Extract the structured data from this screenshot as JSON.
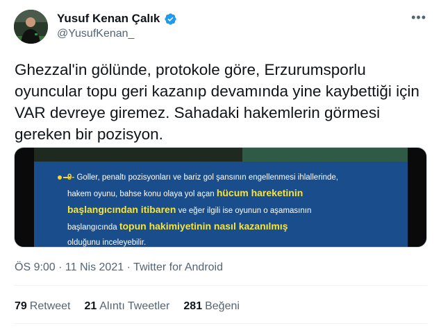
{
  "author": {
    "name": "Yusuf Kenan Çalık",
    "handle": "@YusufKenan_"
  },
  "tweet": {
    "text": "Ghezzal'in gölünde, protokole göre, Erzurumsporlu oyuncular topu geri kazanıp devamında yine kaybettiği için VAR devreye giremez. Sahadaki hakemlerin görmesi gereken bir pozisyon.",
    "media": {
      "number": "9-",
      "line1": "Goller, penaltı pozisyonları ve bariz gol şansının engellenmesi ihlallerinde,",
      "line2a": "hakem oyunu,  bahse konu olaya yol açan ",
      "hl1": "hücum hareketinin",
      "hl2": "başlangıcından itibaren",
      "line3": " ve eğer ilgili ise oyunun o aşamasının",
      "line4a": "başlangıcında ",
      "hl3": "topun hakimiyetinin nasıl kazanılmış",
      "line5": "olduğunu inceleyebilir."
    },
    "meta": "ÖS 9:00 · 11 Nis 2021 · Twitter for Android"
  },
  "stats": {
    "retweets_count": "79",
    "retweets_label": "Retweet",
    "quotes_count": "21",
    "quotes_label": "Alıntı Tweetler",
    "likes_count": "281",
    "likes_label": "Beğeni"
  },
  "colors": {
    "verified": "#1d9bf0",
    "highlight": "#f7e53a",
    "slide_bg": "#1a4d8c"
  },
  "icons": {
    "verified": "verified-badge-icon",
    "more": "more-options-icon"
  }
}
